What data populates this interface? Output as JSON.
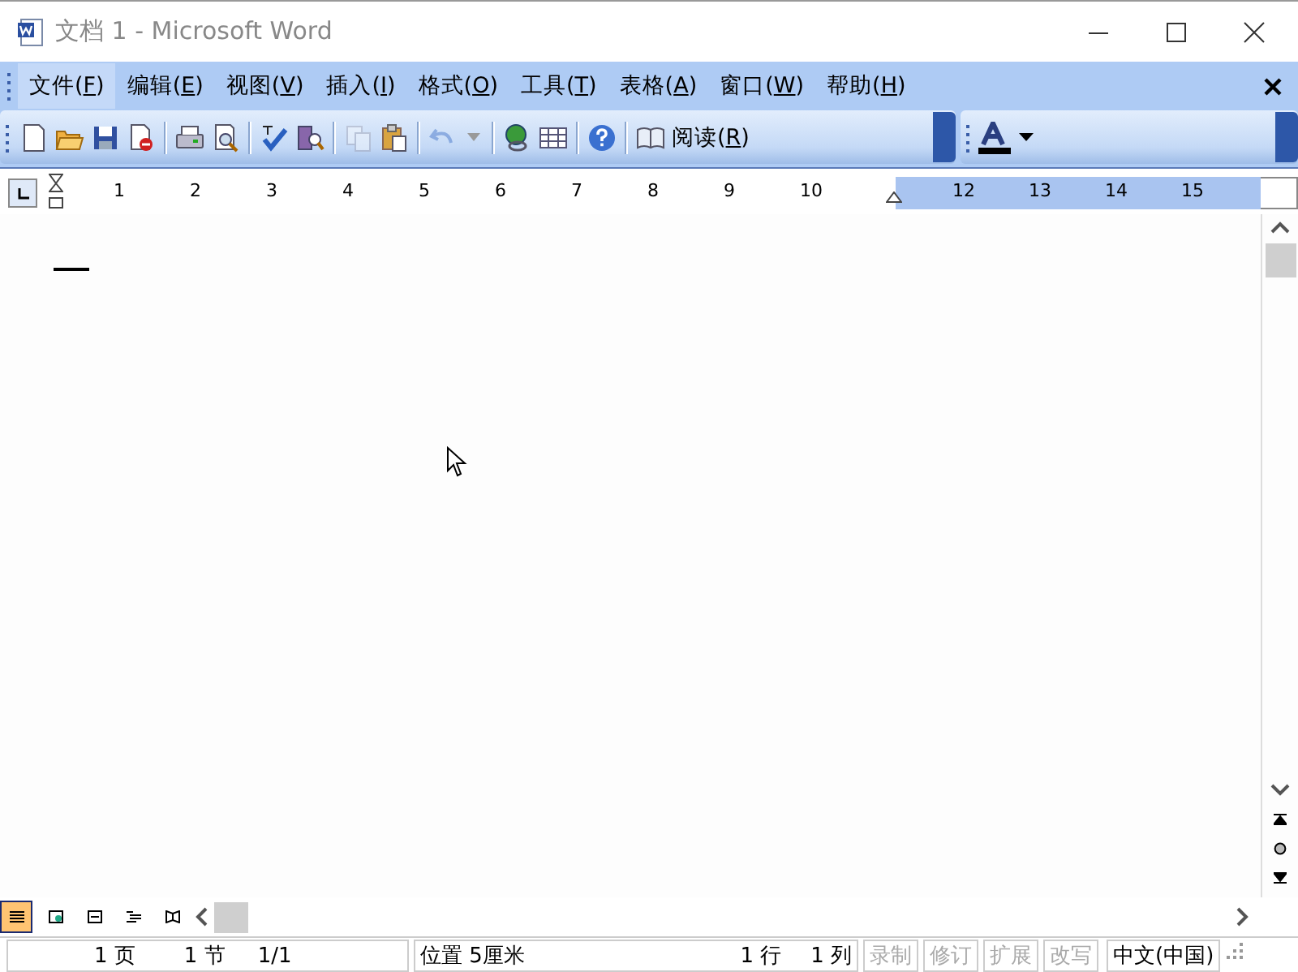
{
  "window": {
    "title": "文档 1 - Microsoft Word"
  },
  "menu": [
    {
      "label": "文件(F)",
      "selected": true
    },
    {
      "label": "编辑(E)",
      "selected": false
    },
    {
      "label": "视图(V)",
      "selected": false
    },
    {
      "label": "插入(I)",
      "selected": false
    },
    {
      "label": "格式(O)",
      "selected": false
    },
    {
      "label": "工具(T)",
      "selected": false
    },
    {
      "label": "表格(A)",
      "selected": false
    },
    {
      "label": "窗口(W)",
      "selected": false
    },
    {
      "label": "帮助(H)",
      "selected": false
    }
  ],
  "toolbar": [
    {
      "kind": "new",
      "disabled": false
    },
    {
      "kind": "open",
      "disabled": false
    },
    {
      "kind": "save",
      "disabled": false
    },
    {
      "kind": "permission",
      "disabled": false
    },
    {
      "kind": "sep"
    },
    {
      "kind": "print",
      "disabled": false
    },
    {
      "kind": "preview",
      "disabled": false
    },
    {
      "kind": "sep"
    },
    {
      "kind": "spell",
      "disabled": false
    },
    {
      "kind": "research",
      "disabled": false
    },
    {
      "kind": "sep"
    },
    {
      "kind": "copy",
      "disabled": true
    },
    {
      "kind": "paste",
      "disabled": false
    },
    {
      "kind": "sep"
    },
    {
      "kind": "undo",
      "disabled": true
    },
    {
      "kind": "sep"
    },
    {
      "kind": "link",
      "disabled": false
    },
    {
      "kind": "table",
      "disabled": false
    },
    {
      "kind": "sep"
    },
    {
      "kind": "help",
      "disabled": false
    },
    {
      "kind": "sep"
    },
    {
      "kind": "read",
      "label": "阅读(R)",
      "disabled": false
    }
  ],
  "ruler": {
    "numbers": [
      "1",
      "2",
      "3",
      "4",
      "5",
      "6",
      "7",
      "8",
      "9",
      "10",
      "12",
      "13",
      "14",
      "15"
    ]
  },
  "view_buttons": [
    {
      "kind": "normal",
      "selected": true
    },
    {
      "kind": "web",
      "selected": false
    },
    {
      "kind": "print",
      "selected": false
    },
    {
      "kind": "outline",
      "selected": false
    },
    {
      "kind": "reading",
      "selected": false
    }
  ],
  "status_bar": {
    "page": "1 页",
    "section": "1 节",
    "pages": "1/1",
    "position": "位置 5厘米",
    "line": "1 行",
    "column": "1 列",
    "modes": [
      {
        "label": "录制",
        "disabled": true
      },
      {
        "label": "修订",
        "disabled": true
      },
      {
        "label": "扩展",
        "disabled": true
      },
      {
        "label": "改写",
        "disabled": true
      }
    ],
    "language": "中文(中国)"
  }
}
